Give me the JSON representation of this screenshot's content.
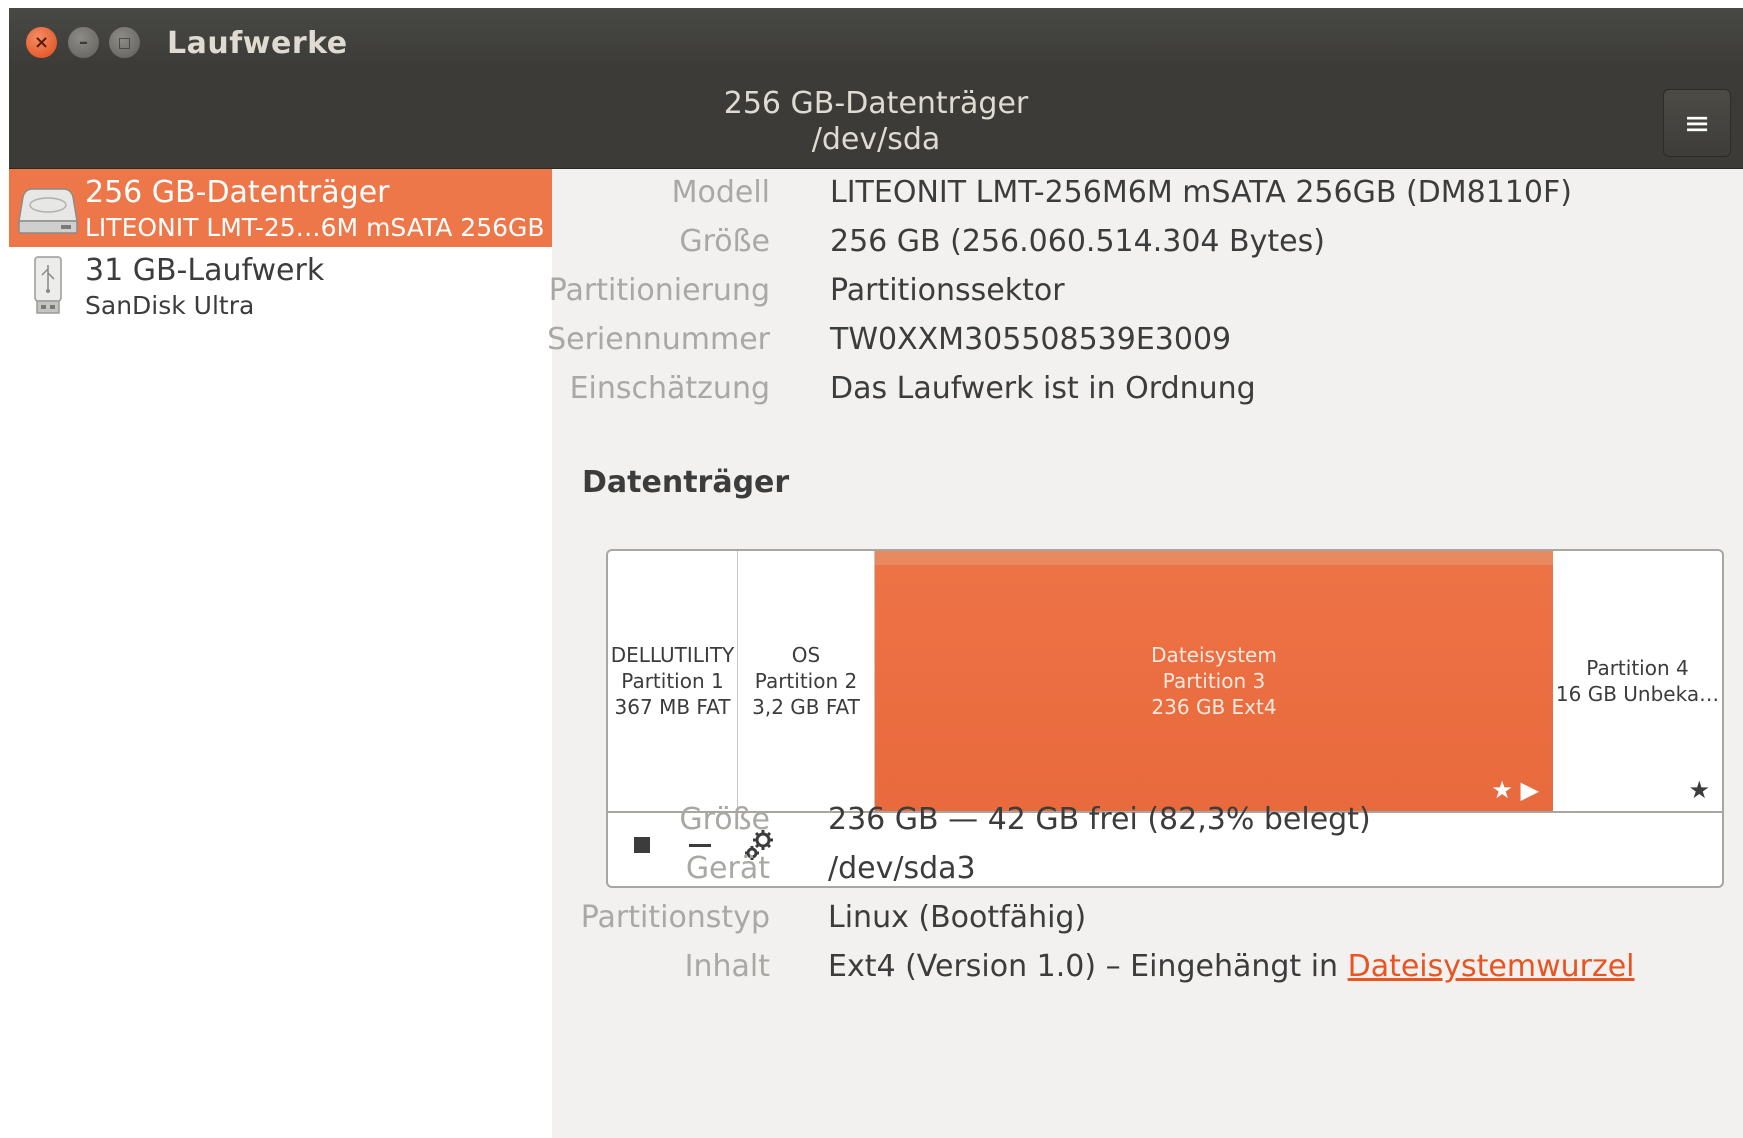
{
  "window": {
    "title": "Laufwerke"
  },
  "header": {
    "title": "256 GB-Datenträger",
    "subtitle": "/dev/sda",
    "menu_icon": "hamburger-menu-icon"
  },
  "sidebar": {
    "drives": [
      {
        "name": "256 GB-Datenträger",
        "subtitle": "LITEONIT LMT-25…6M mSATA 256GB",
        "icon": "hard-disk-icon",
        "selected": true
      },
      {
        "name": "31 GB-Laufwerk",
        "subtitle": "SanDisk Ultra",
        "icon": "usb-drive-icon",
        "selected": false
      }
    ]
  },
  "drive_info": {
    "model_label": "Modell",
    "model": "LITEONIT LMT-256M6M mSATA 256GB (DM8110F)",
    "size_label": "Größe",
    "size": "256 GB (256.060.514.304 Bytes)",
    "partitioning_label": "Partitionierung",
    "partitioning": "Partitionssektor",
    "serial_label": "Seriennummer",
    "serial": "TW0XXM305508539E3009",
    "assessment_label": "Einschätzung",
    "assessment": "Das Laufwerk ist in Ordnung"
  },
  "volumes": {
    "section_title": "Datenträger",
    "partitions": [
      {
        "line1": "DELLUTILITY",
        "line2": "Partition 1",
        "line3": "367 MB FAT"
      },
      {
        "line1": "OS",
        "line2": "Partition 2",
        "line3": "3,2 GB FAT"
      },
      {
        "line1": "Dateisystem",
        "line2": "Partition 3",
        "line3": "236 GB Ext4",
        "selected": true,
        "marks": "★ ▶"
      },
      {
        "line1": "Partition 4",
        "line2": "16 GB Unbeka…",
        "marks": "★"
      }
    ],
    "tools": [
      "stop-icon",
      "minus-icon",
      "gears-icon"
    ]
  },
  "partition_info": {
    "size_label": "Größe",
    "size": "236 GB — 42 GB frei (82,3% belegt)",
    "device_label": "Gerät",
    "device": "/dev/sda3",
    "type_label": "Partitionstyp",
    "type": "Linux (Bootfähig)",
    "content_label": "Inhalt",
    "content": "Ext4 (Version 1.0) – Eingehängt in ",
    "content_link": "Dateisystemwurzel"
  },
  "colors": {
    "accent": "#ed7749",
    "titlebar": "#3c3b37",
    "close": "#df4a16"
  }
}
